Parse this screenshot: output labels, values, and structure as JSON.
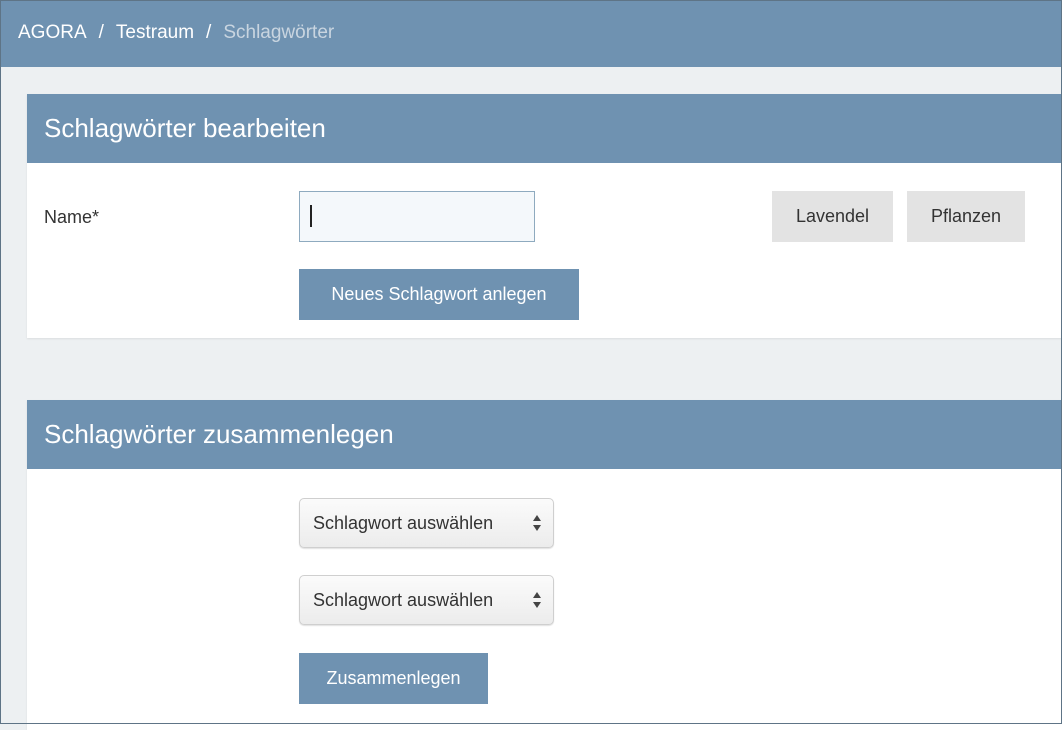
{
  "breadcrumb": {
    "items": [
      "AGORA",
      "Testraum",
      "Schlagwörter"
    ],
    "separator": "/"
  },
  "edit_panel": {
    "title": "Schlagwörter bearbeiten",
    "name_label": "Name*",
    "name_value": "",
    "create_button": "Neues Schlagwort anlegen",
    "tags": [
      "Lavendel",
      "Pflanzen"
    ]
  },
  "merge_panel": {
    "title": "Schlagwörter zusammenlegen",
    "select_1": "Schlagwort auswählen",
    "select_2": "Schlagwort auswählen",
    "merge_button": "Zusammenlegen"
  },
  "colors": {
    "header": "#6f92b1",
    "background": "#edf0f2",
    "tag_background": "#e3e3e3"
  }
}
